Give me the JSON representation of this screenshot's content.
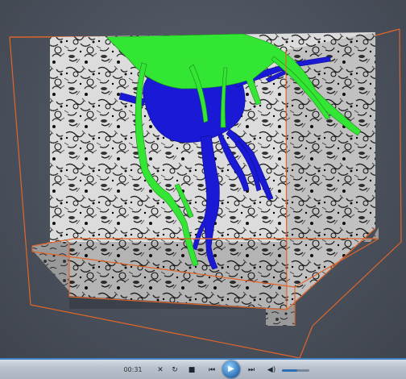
{
  "player": {
    "time": "00:31",
    "controls": {
      "shuffle": "✕",
      "repeat": "↻",
      "stop": "■",
      "previous": "⏮",
      "play": "▶",
      "next": "⏭",
      "volume": "◀)"
    },
    "volume_level": 0.55
  },
  "colors": {
    "bounding_box": "#e0662a",
    "dendrite_green": "#33e633",
    "neuron_blue": "#1a1ad6",
    "background": "#4e5561",
    "progress_line": "#3f7fbf"
  }
}
